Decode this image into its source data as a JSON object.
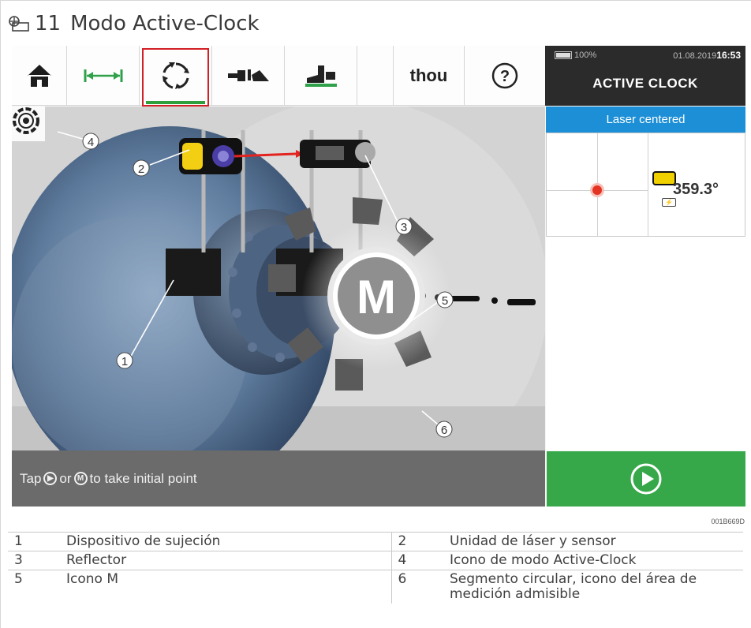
{
  "figure": {
    "number": "11",
    "title": "Modo Active-Clock",
    "id": "001B669D"
  },
  "toolbar": {
    "items": [
      {
        "name": "home-icon"
      },
      {
        "name": "dimensions-icon"
      },
      {
        "name": "active-clock-icon",
        "selected": true
      },
      {
        "name": "alignment-icon"
      },
      {
        "name": "soft-foot-icon"
      },
      {
        "name": "blank"
      },
      {
        "name": "units",
        "label": "thou"
      },
      {
        "name": "help-icon",
        "label": "?"
      }
    ]
  },
  "status": {
    "battery": "100%",
    "date": "01.08.2019",
    "time": "16:53",
    "mode": "ACTIVE CLOCK"
  },
  "laser": {
    "status": "Laser centered",
    "angle": "359.3°"
  },
  "hint": {
    "prefix": "Tap",
    "or": "or",
    "m": "M",
    "suffix": "to take initial point"
  },
  "callouts": [
    "1",
    "2",
    "3",
    "4",
    "5",
    "6"
  ],
  "scene": {
    "m_label": "M"
  },
  "legend": [
    {
      "n1": "1",
      "t1": "Dispositivo de sujeción",
      "n2": "2",
      "t2": "Unidad de láser y sensor"
    },
    {
      "n1": "3",
      "t1": "Reflector",
      "n2": "4",
      "t2": "Icono de modo Active-Clock"
    },
    {
      "n1": "5",
      "t1": "Icono M",
      "n2": "6",
      "t2": "Segmento circular, icono del área de medición admisible"
    }
  ],
  "colors": {
    "selected_underline": "#2f9e3c",
    "selected_box": "#d31f26",
    "status_bar": "#1c8fd6",
    "play_button": "#36a849"
  }
}
